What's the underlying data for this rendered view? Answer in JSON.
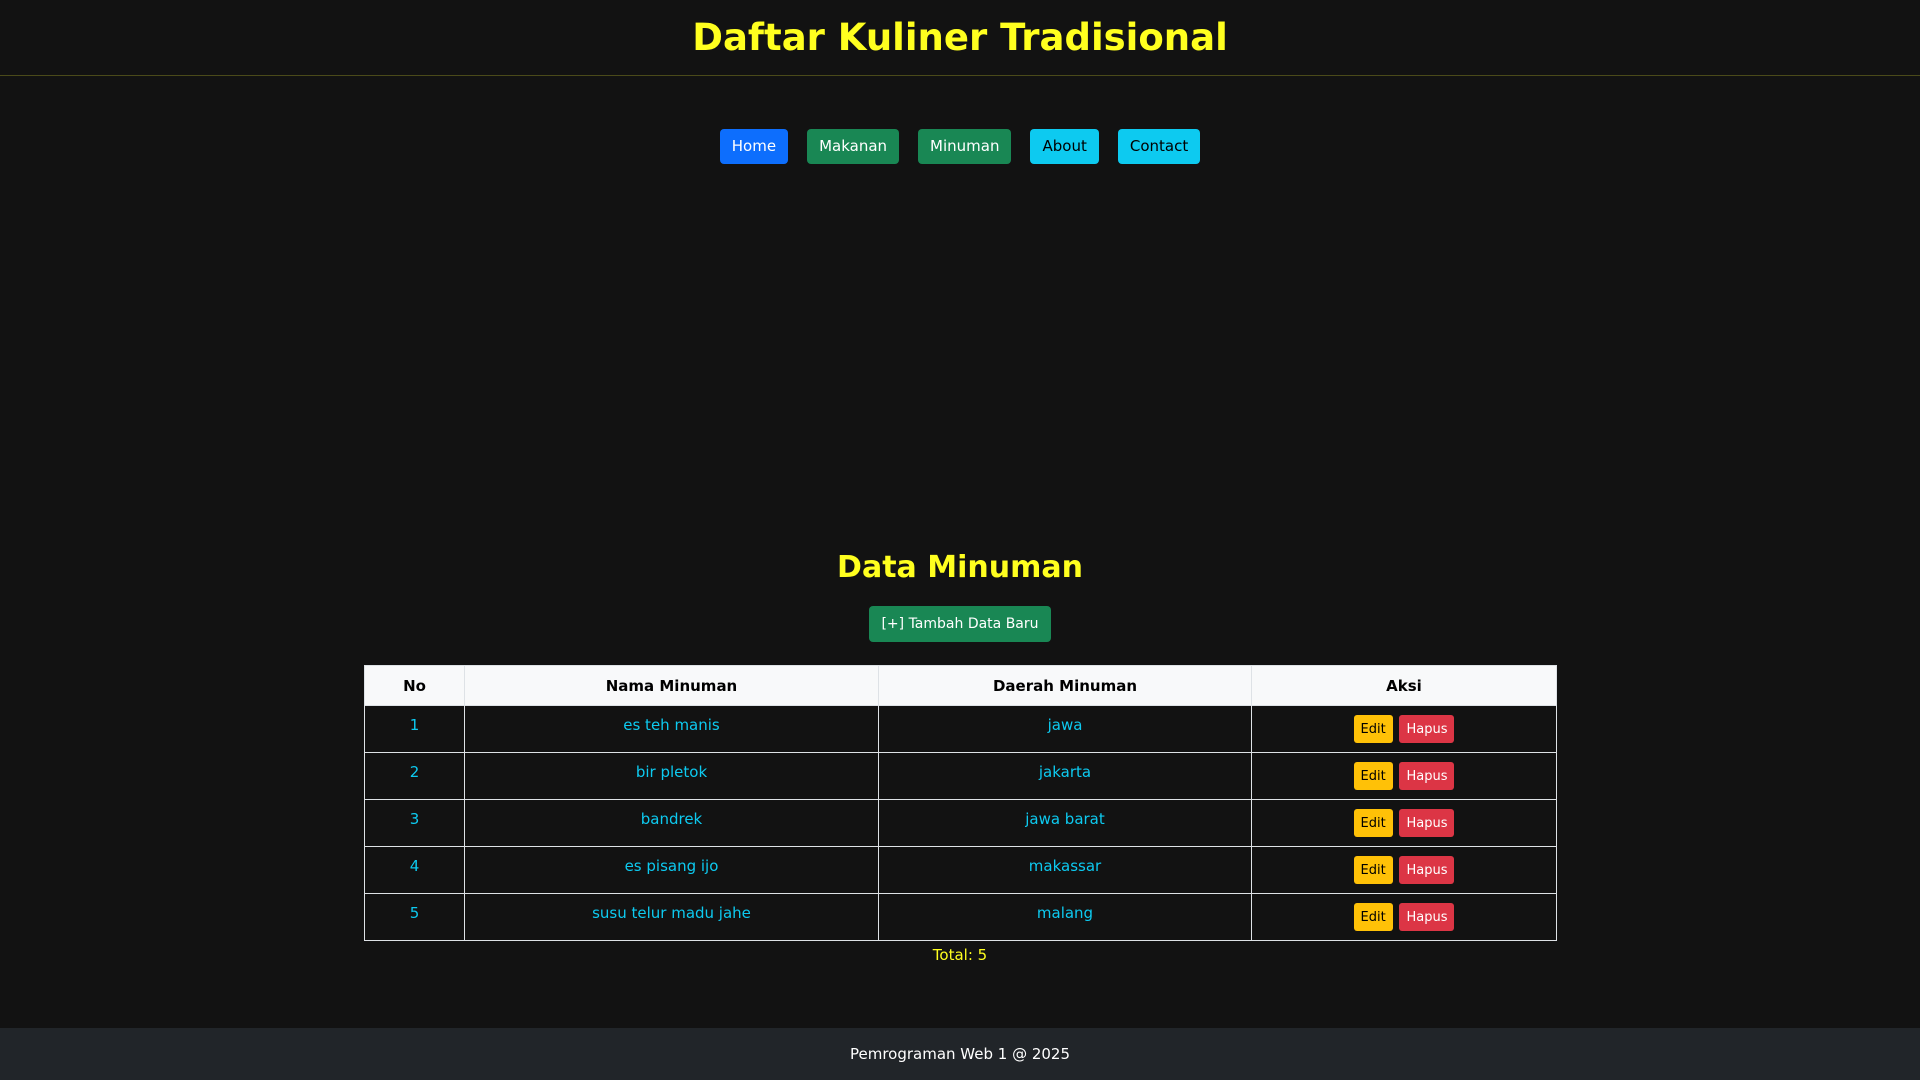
{
  "header": {
    "title": "Daftar Kuliner Tradisional"
  },
  "nav": {
    "home": "Home",
    "makanan": "Makanan",
    "minuman": "Minuman",
    "about": "About",
    "contact": "Contact"
  },
  "section": {
    "title": "Data Minuman",
    "add_button": "[+] Tambah Data Baru"
  },
  "table": {
    "columns": [
      "No",
      "Nama Minuman",
      "Daerah Minuman",
      "Aksi"
    ],
    "rows": [
      {
        "no": "1",
        "nama": "es teh manis",
        "daerah": "jawa"
      },
      {
        "no": "2",
        "nama": "bir pletok",
        "daerah": "jakarta"
      },
      {
        "no": "3",
        "nama": "bandrek",
        "daerah": "jawa barat"
      },
      {
        "no": "4",
        "nama": "es pisang ijo",
        "daerah": "makassar"
      },
      {
        "no": "5",
        "nama": "susu telur madu jahe",
        "daerah": "malang"
      }
    ],
    "edit_label": "Edit",
    "delete_label": "Hapus"
  },
  "total": "Total: 5",
  "footer": {
    "text": "Pemrograman Web 1 @ 2025"
  },
  "colors": {
    "background": "#121212",
    "title_yellow": "#ffff1f",
    "primary": "#0d6efd",
    "success": "#198754",
    "info": "#0dcaf0",
    "warning": "#ffc107",
    "danger": "#dc3545",
    "footer_bg": "#212529"
  }
}
